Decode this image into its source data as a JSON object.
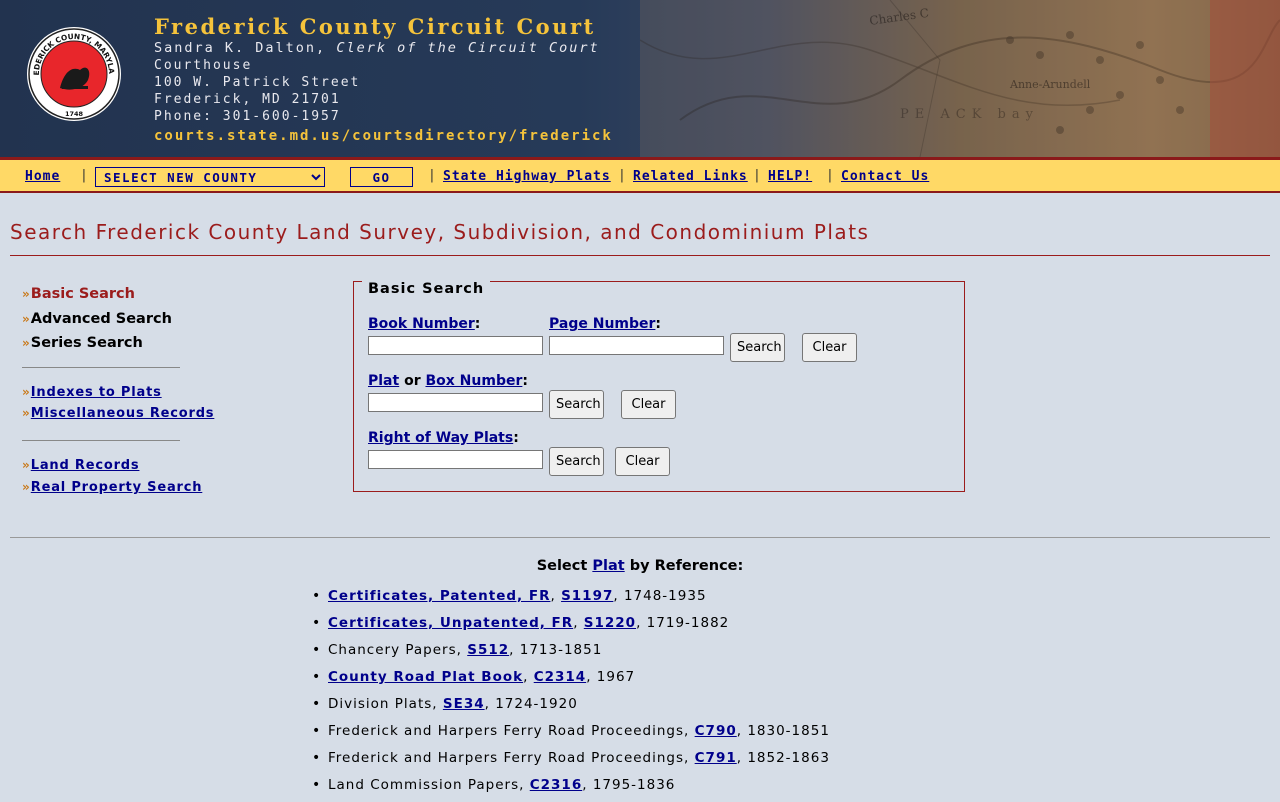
{
  "header": {
    "title": "Frederick County Circuit Court",
    "clerk_name": "Sandra K. Dalton,",
    "clerk_title": "Clerk of the Circuit Court",
    "line1": "Courthouse",
    "line2": "100 W. Patrick Street",
    "line3": "Frederick, MD 21701",
    "line4": "Phone: 301-600-1957",
    "url": "courts.state.md.us/courtsdirectory/frederick",
    "seal_text_top": "FREDERICK COUNTY, MARYLAND",
    "seal_year": "1748",
    "map_labels": [
      "Charles C",
      "Anne-Arundell",
      "PE ACK bay"
    ]
  },
  "nav": {
    "home": "Home",
    "county_select": "SELECT NEW COUNTY",
    "go": "GO",
    "state_highway": "State Highway Plats",
    "related": "Related Links",
    "help": "HELP!",
    "contact": "Contact Us",
    "separator": "|"
  },
  "page_title": "Search Frederick County Land Survey, Subdivision, and Condominium Plats",
  "sidebar": {
    "arrow": "»",
    "group1": [
      "Basic Search",
      "Advanced Search",
      "Series Search"
    ],
    "group2": [
      "Indexes to Plats",
      "Miscellaneous Records"
    ],
    "group3": [
      "Land Records",
      "Real Property Search"
    ]
  },
  "basic_search": {
    "legend": "Basic Search",
    "book_label": "Book Number",
    "page_label": "Page Number",
    "colon": ":",
    "plat_label": "Plat",
    "or_text": "or",
    "box_label": "Box Number",
    "row_label": "Right of Way Plats",
    "search_btn": "Search",
    "clear_btn": "Clear"
  },
  "reference": {
    "heading_pre": "Select",
    "heading_link": "Plat",
    "heading_post": "by Reference:",
    "items": [
      {
        "title": "Certificates, Patented, FR",
        "title_link": true,
        "series": "S1197",
        "years": "1748-1935"
      },
      {
        "title": "Certificates, Unpatented, FR",
        "title_link": true,
        "series": "S1220",
        "years": "1719-1882"
      },
      {
        "title": "Chancery Papers",
        "title_link": false,
        "series": "S512",
        "years": "1713-1851"
      },
      {
        "title": "County Road Plat Book",
        "title_link": true,
        "series": "C2314",
        "years": "1967"
      },
      {
        "title": "Division Plats",
        "title_link": false,
        "series": "SE34",
        "years": "1724-1920"
      },
      {
        "title": "Frederick and Harpers Ferry Road Proceedings",
        "title_link": false,
        "series": "C790",
        "years": "1830-1851"
      },
      {
        "title": "Frederick and Harpers Ferry Road Proceedings",
        "title_link": false,
        "series": "C791",
        "years": "1852-1863"
      },
      {
        "title": "Land Commission Papers",
        "title_link": false,
        "series": "C2316",
        "years": "1795-1836"
      }
    ]
  },
  "colors": {
    "header_bg": "#22334f",
    "gold": "#f5c33b",
    "nav_bg": "#ffd966",
    "accent_red": "#9b1c1c",
    "link": "#00008b",
    "page_bg": "#d6dde7"
  }
}
